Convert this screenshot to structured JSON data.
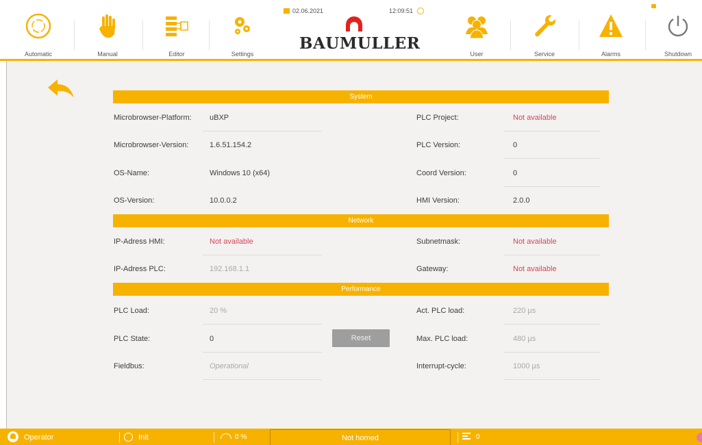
{
  "toolbar": {
    "automatic": "Automatic",
    "manual": "Manual",
    "editor": "Editor",
    "settings": "Settings",
    "date": "02.06.2021",
    "time": "12:09:51",
    "brand": "BAUMULLER",
    "user": "User",
    "service": "Service",
    "alarms": "Alarms",
    "shutdown": "Shutdown"
  },
  "sections": {
    "system": "System",
    "network": "Network",
    "performance": "Performance"
  },
  "system": {
    "mb_platform_label": "Microbrowser-Platform:",
    "mb_platform_value": "uBXP",
    "mb_version_label": "Microbrowser-Version:",
    "mb_version_value": "1.6.51.154.2",
    "os_name_label": "OS-Name:",
    "os_name_value": "Windows 10 (x64)",
    "os_version_label": "OS-Version:",
    "os_version_value": "10.0.0.2",
    "plc_project_label": "PLC Project:",
    "plc_project_value": "Not available",
    "plc_version_label": "PLC Version:",
    "plc_version_value": "0",
    "coord_version_label": "Coord Version:",
    "coord_version_value": "0",
    "hmi_version_label": "HMI Version:",
    "hmi_version_value": "2.0.0"
  },
  "network": {
    "ip_hmi_label": "IP-Adress HMI:",
    "ip_hmi_value": "Not available",
    "ip_plc_label": "IP-Adress PLC:",
    "ip_plc_value": "192.168.1.1",
    "subnet_label": "Subnetmask:",
    "subnet_value": "Not available",
    "gateway_label": "Gateway:",
    "gateway_value": "Not available"
  },
  "performance": {
    "plc_load_label": "PLC Load:",
    "plc_load_value": "20 %",
    "plc_state_label": "PLC State:",
    "plc_state_value": "0",
    "reset_label": "Reset",
    "fieldbus_label": "Fieldbus:",
    "fieldbus_value": "Operational",
    "act_load_label": "Act. PLC load:",
    "act_load_value": "220 µs",
    "max_load_label": "Max. PLC load:",
    "max_load_value": "480 µs",
    "interrupt_label": "Interrupt-cycle:",
    "interrupt_value": "1000 µs"
  },
  "statusbar": {
    "user": "Operator",
    "state": "Init",
    "override": "0 %",
    "homed": "Not homed",
    "program": "0"
  },
  "colors": {
    "accent": "#f7b200",
    "not_available": "#d5445a",
    "reset_button": "#9e9e9e"
  }
}
